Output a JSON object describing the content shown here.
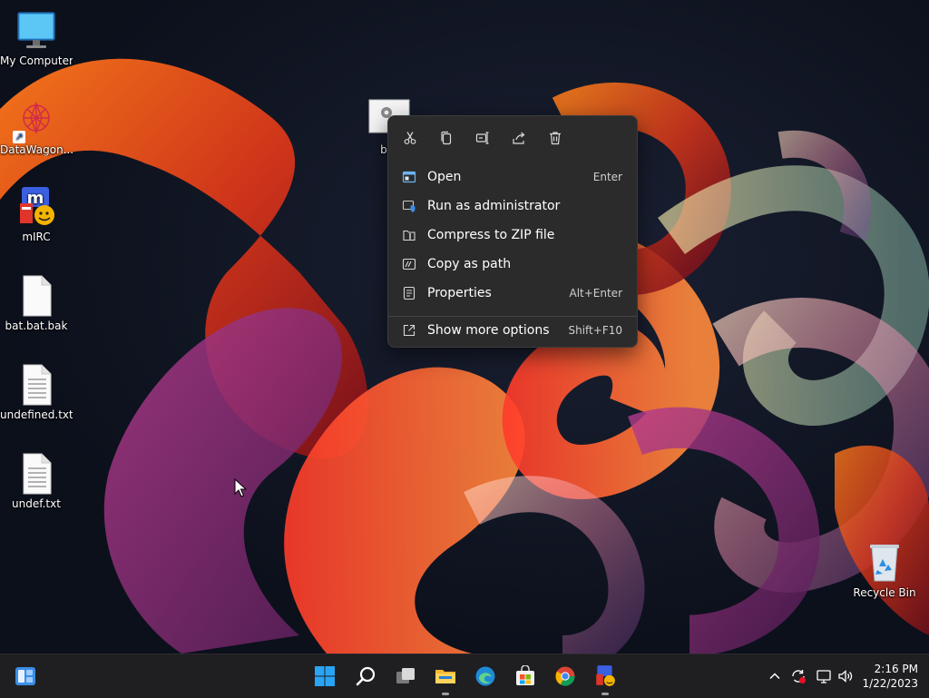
{
  "desktop": {
    "icons": [
      {
        "label": "My Computer",
        "icon": "monitor-icon"
      },
      {
        "label": "DataWagon...",
        "icon": "datawagon-icon"
      },
      {
        "label": "mIRC",
        "icon": "mirc-icon"
      },
      {
        "label": "bat.bat.bak",
        "icon": "blank-file-icon"
      },
      {
        "label": "undefined.txt",
        "icon": "text-file-icon"
      },
      {
        "label": "undef.txt",
        "icon": "text-file-icon"
      },
      {
        "label": "Recycle Bin",
        "icon": "recycle-bin-icon"
      }
    ],
    "selected_icon": {
      "label": "bat",
      "icon": "batch-file-icon"
    }
  },
  "context_menu": {
    "toolbar": [
      {
        "name": "cut",
        "icon": "scissors-icon"
      },
      {
        "name": "copy",
        "icon": "copy-icon"
      },
      {
        "name": "rename",
        "icon": "rename-icon"
      },
      {
        "name": "share",
        "icon": "share-icon"
      },
      {
        "name": "delete",
        "icon": "trash-icon"
      }
    ],
    "items": [
      {
        "label": "Open",
        "shortcut": "Enter",
        "icon": "open-window-icon"
      },
      {
        "label": "Run as administrator",
        "shortcut": "",
        "icon": "shield-icon"
      },
      {
        "label": "Compress to ZIP file",
        "shortcut": "",
        "icon": "zip-icon"
      },
      {
        "label": "Copy as path",
        "shortcut": "",
        "icon": "path-icon"
      },
      {
        "label": "Properties",
        "shortcut": "Alt+Enter",
        "icon": "properties-icon"
      },
      {
        "label": "Show more options",
        "shortcut": "Shift+F10",
        "icon": "more-options-icon"
      }
    ]
  },
  "taskbar": {
    "apps": [
      "widgets-icon",
      "start-icon",
      "search-icon",
      "task-view-icon",
      "file-explorer-icon",
      "edge-icon",
      "store-icon",
      "chrome-icon",
      "mirc-icon"
    ],
    "tray": [
      "chevron-up-icon",
      "sync-icon",
      "network-icon",
      "volume-icon"
    ],
    "time": "2:16 PM",
    "date": "1/22/2023"
  },
  "colors": {
    "accent": "#0078d4",
    "menu_bg": "#2b2b2b",
    "taskbar_bg": "#1f1f22"
  }
}
